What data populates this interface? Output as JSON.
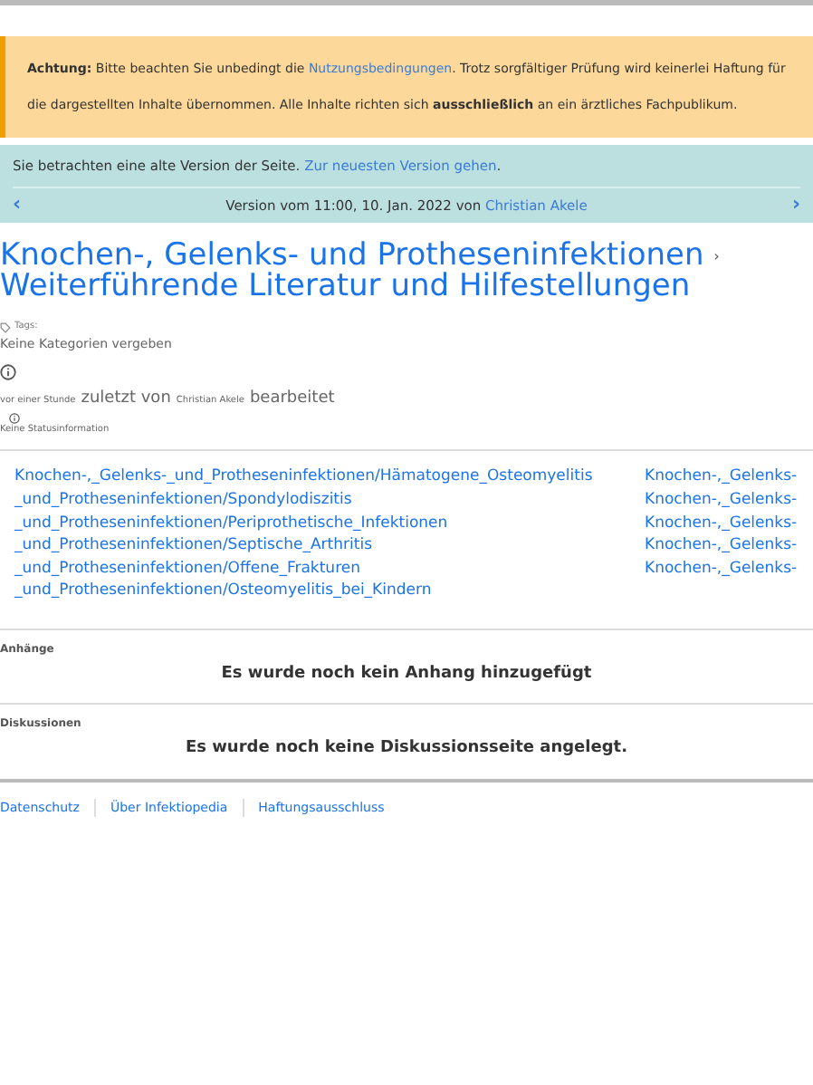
{
  "notice": {
    "label": "Achtung:",
    "text_before": "Bitte beachten Sie unbedingt die",
    "link": "Nutzungsbedingungen",
    "text_after": ". Trotz sorgfältiger Prüfung wird keinerlei Haftung für die dargestellten Inhalte übernommen. Alle Inhalte richten sich **ausschließlich** an ein ärztliches Fachpublikum."
  },
  "version_bar": {
    "text": "Sie betrachten eine alte Version der Seite.",
    "link": "Zur neuesten Version gehen",
    "period": ".",
    "prev": "‹",
    "next": "›",
    "version_text": "Version vom 11:00, 10. Jan. 2022 von",
    "author": "Christian Akele"
  },
  "title": {
    "line1": "Knochen-, Gelenks- und Protheseninfektionen",
    "separator": "›",
    "line2": "Weiterführende Literatur und Hilfestellungen"
  },
  "tags": {
    "label": "Tags:",
    "value": "Keine Kategorien vergeben"
  },
  "edit_info": {
    "time": "vor einer Stunde",
    "mid": "zuletzt von",
    "author": "Christian Akele",
    "end": "bearbeitet"
  },
  "status": "Keine Statusinformation",
  "links": {
    "left": [
      "Knochen-,_Gelenks-_und_Protheseninfektionen/Hämatogene_Osteomyelitis",
      "_und_Protheseninfektionen/Spondylodiszitis",
      "_und_Protheseninfektionen/Periprothetische_Infektionen",
      "_und_Protheseninfektionen/Septische_Arthritis",
      "_und_Protheseninfektionen/Offene_Frakturen",
      "_und_Protheseninfektionen/Osteomyelitis_bei_Kindern"
    ],
    "right": [
      "Knochen-,_Gelenks-",
      "Knochen-,_Gelenks-",
      "Knochen-,_Gelenks-",
      "Knochen-,_Gelenks-",
      "Knochen-,_Gelenks-"
    ]
  },
  "sections": [
    {
      "heading": "Anhänge",
      "message": "Es wurde noch kein Anhang hinzugefügt"
    },
    {
      "heading": "Diskussionen",
      "message": "Es wurde noch keine Diskussionsseite angelegt."
    }
  ],
  "footer": [
    "Datenschutz",
    "Über Infektiopedia",
    "Haftungsausschluss"
  ]
}
